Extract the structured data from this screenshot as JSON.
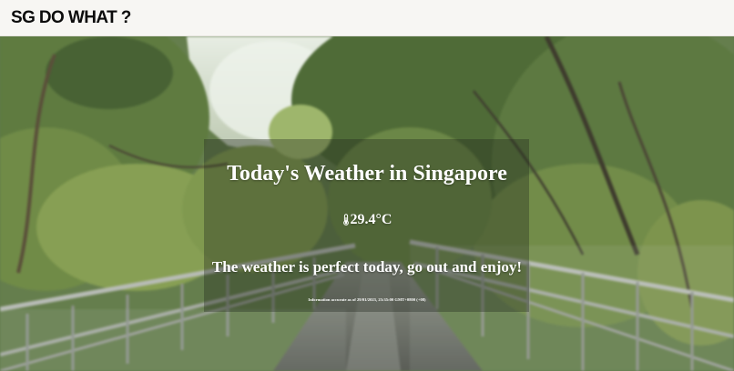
{
  "header": {
    "brand": "SG DO WHAT ?"
  },
  "hero": {
    "title": "Today's Weather in Singapore",
    "temperature": "29.4°C",
    "temperature_icon": "thermometer-icon",
    "message": "The weather is perfect today, go out and enjoy!",
    "accuracy_note": "Information accurate as of 29/01/2023, 23:35:00 GMT+0800 (+08)"
  }
}
